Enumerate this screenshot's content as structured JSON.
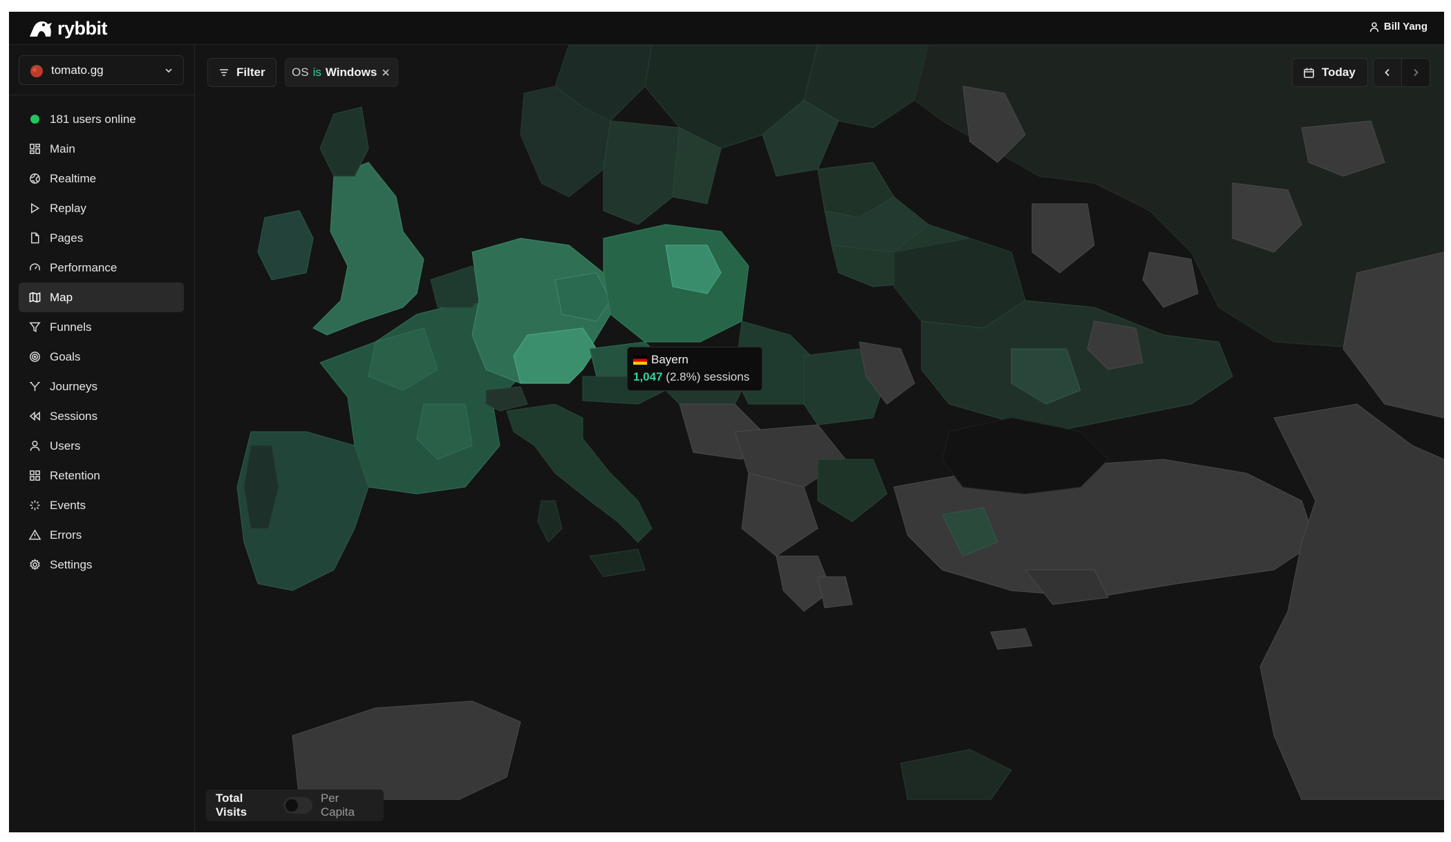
{
  "app": {
    "brand": "rybbit",
    "user_name": "Bill Yang",
    "accent_color": "#34d399"
  },
  "site": {
    "name": "tomato.gg"
  },
  "sidebar": {
    "online_text": "181 users online",
    "items": [
      {
        "label": "Main",
        "icon": "grid-icon"
      },
      {
        "label": "Realtime",
        "icon": "globe-icon"
      },
      {
        "label": "Replay",
        "icon": "play-icon"
      },
      {
        "label": "Pages",
        "icon": "file-icon"
      },
      {
        "label": "Performance",
        "icon": "gauge-icon"
      },
      {
        "label": "Map",
        "icon": "map-icon",
        "active": true
      },
      {
        "label": "Funnels",
        "icon": "funnel-icon"
      },
      {
        "label": "Goals",
        "icon": "target-icon"
      },
      {
        "label": "Journeys",
        "icon": "split-icon"
      },
      {
        "label": "Sessions",
        "icon": "rewind-icon"
      },
      {
        "label": "Users",
        "icon": "user-icon"
      },
      {
        "label": "Retention",
        "icon": "grid-icon"
      },
      {
        "label": "Events",
        "icon": "sparkle-icon"
      },
      {
        "label": "Errors",
        "icon": "warning-icon"
      },
      {
        "label": "Settings",
        "icon": "gear-icon"
      }
    ]
  },
  "toolbar": {
    "filter_label": "Filter",
    "chip": {
      "key": "OS",
      "operator": "is",
      "value": "Windows"
    },
    "date_label": "Today"
  },
  "tooltip": {
    "region": "Bayern",
    "flag": "de-flag-icon",
    "sessions_value": "1,047",
    "sessions_rest": "(2.8%) sessions"
  },
  "legend": {
    "left_label": "Total Visits",
    "right_label": "Per Capita",
    "per_capita_on": false
  }
}
